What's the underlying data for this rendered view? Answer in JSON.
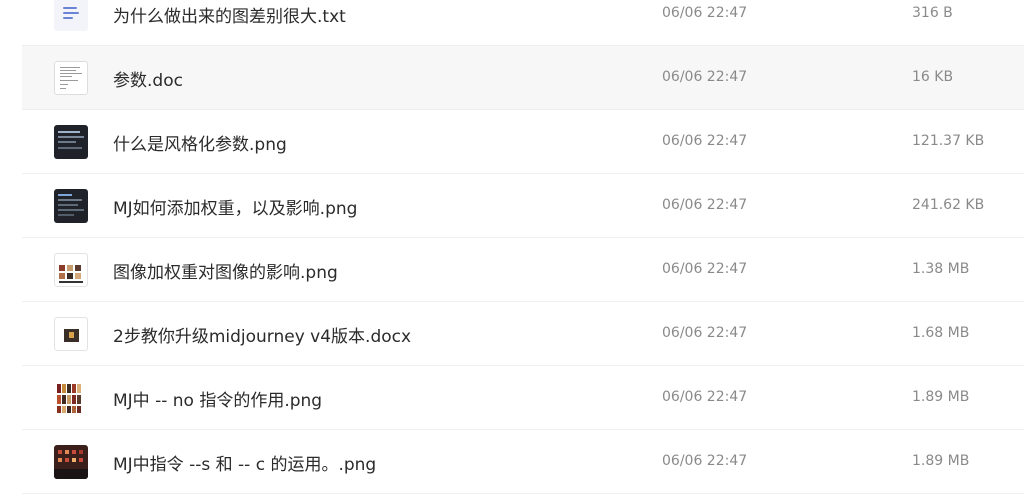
{
  "files": [
    {
      "name": "为什么做出来的图差别很大.txt",
      "date": "06/06 22:47",
      "size": "316 B",
      "thumb_icon": "txt-file-icon"
    },
    {
      "name": "参数.doc",
      "date": "06/06 22:47",
      "size": "16 KB",
      "thumb_icon": "doc-file-icon"
    },
    {
      "name": "什么是风格化参数.png",
      "date": "06/06 22:47",
      "size": "121.37 KB",
      "thumb_icon": "image-thumbnail"
    },
    {
      "name": "MJ如何添加权重，以及影响.png",
      "date": "06/06 22:47",
      "size": "241.62 KB",
      "thumb_icon": "image-thumbnail"
    },
    {
      "name": "图像加权重对图像的影响.png",
      "date": "06/06 22:47",
      "size": "1.38 MB",
      "thumb_icon": "image-thumbnail"
    },
    {
      "name": "2步教你升级midjourney v4版本.docx",
      "date": "06/06 22:47",
      "size": "1.68 MB",
      "thumb_icon": "docx-file-icon"
    },
    {
      "name": "MJ中 -- no 指令的作用.png",
      "date": "06/06 22:47",
      "size": "1.89 MB",
      "thumb_icon": "image-thumbnail"
    },
    {
      "name": "MJ中指令 --s 和 -- c 的运用。.png",
      "date": "06/06 22:47",
      "size": "1.89 MB",
      "thumb_icon": "image-thumbnail"
    }
  ],
  "colors": {
    "hover_row": "#f7f7f7",
    "divider": "#efefef",
    "meta_text": "#8a8a8a"
  }
}
